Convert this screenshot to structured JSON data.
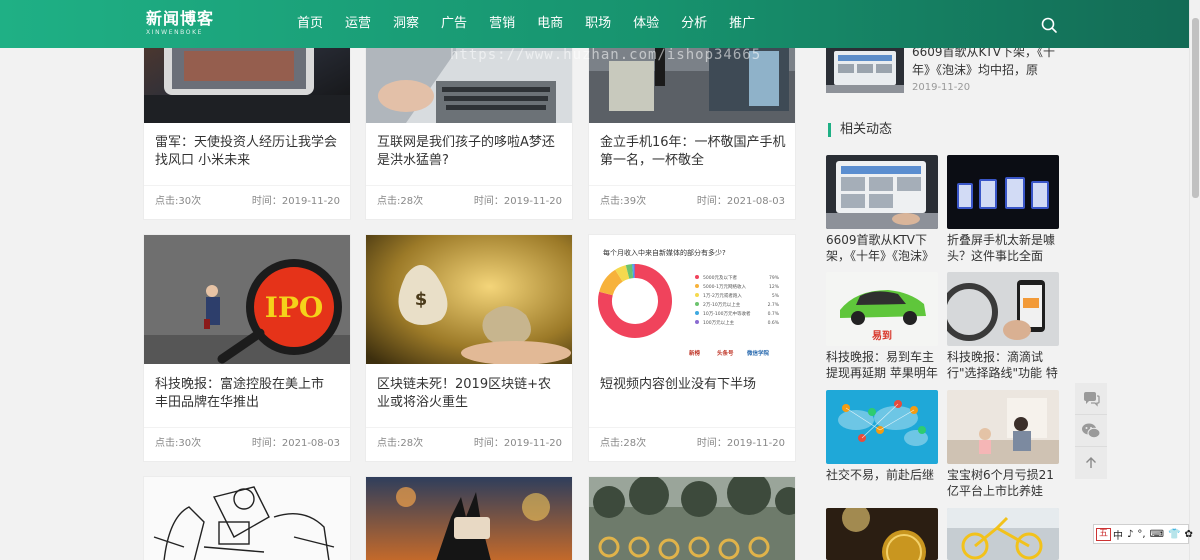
{
  "header": {
    "logo": "新闻博客",
    "logo_sub": "XINWENBOKE",
    "nav": [
      "首页",
      "运营",
      "洞察",
      "广告",
      "营销",
      "电商",
      "职场",
      "体验",
      "分析",
      "推广"
    ]
  },
  "watermark": "https://www.huzhan.com/ishop34665",
  "cards": [
    {
      "title": "雷军：天使投资人经历让我学会找风口 小米未来",
      "clicks": "点击:30次",
      "time": "时间：2019-11-20"
    },
    {
      "title": "互联网是我们孩子的哆啦A梦还是洪水猛兽?",
      "clicks": "点击:28次",
      "time": "时间：2019-11-20"
    },
    {
      "title": "金立手机16年：一杯敬国产手机第一名，一杯敬全",
      "clicks": "点击:39次",
      "time": "时间：2021-08-03"
    },
    {
      "title": "科技晚报：富途控股在美上市 丰田品牌在华推出",
      "clicks": "点击:30次",
      "time": "时间：2021-08-03",
      "img_text": "IPO"
    },
    {
      "title": "区块链未死！2019区块链+农业或将浴火重生",
      "clicks": "点击:28次",
      "time": "时间：2019-11-20"
    },
    {
      "title": "短视频内容创业没有下半场",
      "clicks": "点击:28次",
      "time": "时间：2019-11-20"
    }
  ],
  "donut_chart": {
    "title": "每个月收入中来自新媒体的部分有多少?",
    "legend": [
      {
        "label": "5000元及以下者",
        "value": "79%",
        "color": "#f0435c"
      },
      {
        "label": "5000-1万元网络收入",
        "value": "12%",
        "color": "#f7b23b"
      },
      {
        "label": "1万-2万元或者跑入",
        "value": "5%",
        "color": "#f5d94e"
      },
      {
        "label": "2万-10万元以上主",
        "value": "2.7%",
        "color": "#6cc36e"
      },
      {
        "label": "10万-100万元中等收者",
        "value": "0.7%",
        "color": "#3ea9e0"
      },
      {
        "label": "100万元以上主",
        "value": "0.6%",
        "color": "#8a6bd1"
      }
    ],
    "footer": [
      "新榜",
      "头条号",
      "微信学院"
    ]
  },
  "sidebar": {
    "top_item": {
      "title": "6609首歌从KTV下架，《十年》《泡沫》均中招，原",
      "date": "2019-11-20"
    },
    "section_title": "相关动态",
    "related": [
      {
        "title": "6609首歌从KTV下架，《十年》《泡沫》均..."
      },
      {
        "title": "折叠屏手机太新是噱头？这件事比全面屏..."
      },
      {
        "title": "科技晚报：易到车主提现再延期 苹果明年计..."
      },
      {
        "title": "科技晚报：滴滴试行\"选择路线\"功能 特斯..."
      },
      {
        "title": "社交不易，前赴后继"
      },
      {
        "title": "宝宝树6个月亏损21亿平台上市比养娃难?"
      }
    ]
  },
  "ime": [
    "五",
    "中",
    "♪",
    "°,",
    "⌨",
    "👕",
    "✿"
  ],
  "icons": [
    "search-icon",
    "chat-icon",
    "wechat-icon",
    "arrow-up-icon"
  ]
}
